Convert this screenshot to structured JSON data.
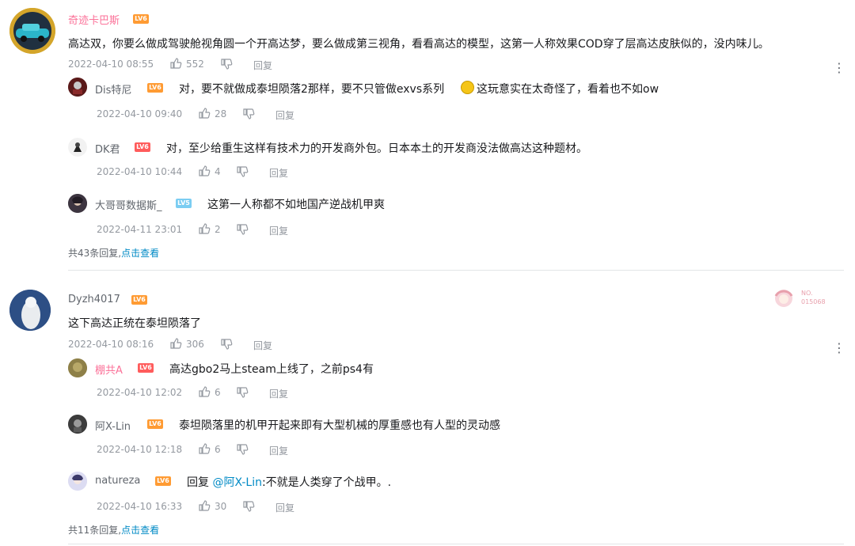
{
  "icons": {
    "like": "thumbs-up-icon",
    "dislike": "thumbs-down-icon",
    "more": "more-vertical-icon"
  },
  "colors": {
    "username_pink": "#fb7299",
    "level_orange": "#ff9b33",
    "level_red": "#ff5c5c",
    "level_blue": "#7bcdf2",
    "link_blue": "#008ac5",
    "meta_gray": "#9499a0"
  },
  "thread1": {
    "user": "奇迹卡巴斯",
    "level": "LV6",
    "text": "高达双，你要么做成驾驶舱视角圆一个开高达梦，要么做成第三视角，看看高达的模型，这第一人称效果COD穿了层高达皮肤似的，没内味儿。",
    "time": "2022-04-10 08:55",
    "likes": "552",
    "reply_label": "回复",
    "replies": [
      {
        "user": "Dis特尼",
        "level": "LV6",
        "text": "对，要不就做成泰坦陨落2那样，要不只管做exvs系列",
        "text2": "这玩意实在太奇怪了，看着也不如ow",
        "time": "2022-04-10 09:40",
        "likes": "28",
        "reply_label": "回复"
      },
      {
        "user": "DK君",
        "level": "LV6",
        "text": "对，至少给重生这样有技术力的开发商外包。日本本土的开发商没法做高达这种题材。",
        "time": "2022-04-10 10:44",
        "likes": "4",
        "reply_label": "回复"
      },
      {
        "user": "大哥哥数据斯_",
        "level": "LV5",
        "text": "这第一人称都不如地国产逆战机甲爽",
        "time": "2022-04-11 23:01",
        "likes": "2",
        "reply_label": "回复"
      }
    ],
    "summary_prefix": "共43条回复,",
    "summary_link": "点击查看"
  },
  "thread2": {
    "user": "Dyzh4017",
    "level": "LV6",
    "text": "这下高达正统在泰坦陨落了",
    "time": "2022-04-10 08:16",
    "likes": "306",
    "reply_label": "回复",
    "badge_top": "NO.",
    "badge_num": "015068",
    "replies": [
      {
        "user": "棚共A",
        "level": "LV6",
        "text": "高达gbo2马上steam上线了，之前ps4有",
        "time": "2022-04-10 12:02",
        "likes": "6",
        "reply_label": "回复"
      },
      {
        "user": "阿X-Lin",
        "level": "LV6",
        "text": "泰坦陨落里的机甲开起来即有大型机械的厚重感也有人型的灵动感",
        "time": "2022-04-10 12:18",
        "likes": "6",
        "reply_label": "回复"
      },
      {
        "user": "natureza",
        "level": "LV6",
        "text_prefix": "回复",
        "mention": "@阿X-Lin",
        "text": ":不就是人类穿了个战甲。.",
        "time": "2022-04-10 16:33",
        "likes": "30",
        "reply_label": "回复"
      }
    ],
    "summary_prefix": "共11条回复,",
    "summary_link": "点击查看"
  }
}
